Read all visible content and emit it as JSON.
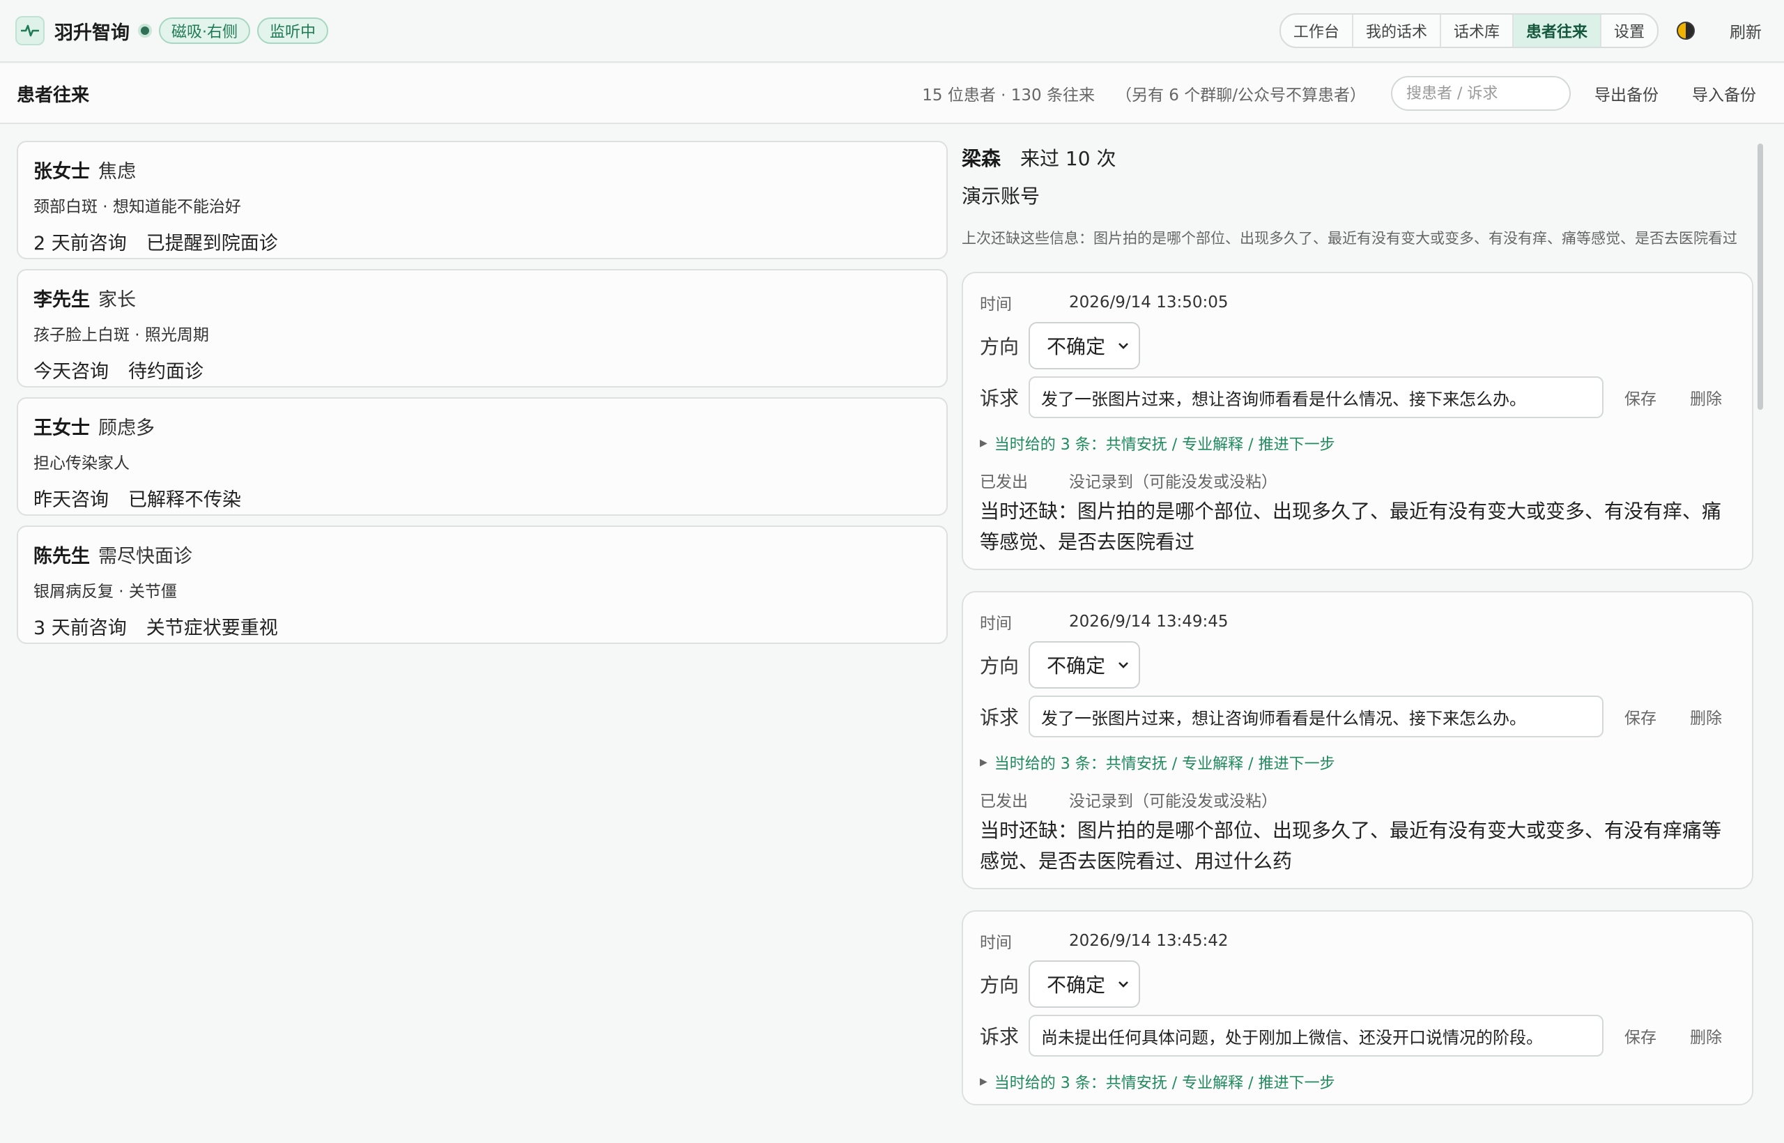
{
  "app": {
    "title": "羽升智询",
    "badges": [
      "磁吸·右侧",
      "监听中"
    ]
  },
  "nav": {
    "tabs": [
      {
        "label": "工作台",
        "active": false
      },
      {
        "label": "我的话术",
        "active": false
      },
      {
        "label": "话术库",
        "active": false
      },
      {
        "label": "患者往来",
        "active": true
      },
      {
        "label": "设置",
        "active": false
      }
    ],
    "refresh_label": "刷新"
  },
  "page": {
    "title": "患者往来",
    "stats": "15 位患者 · 130 条往来",
    "stats_note": "（另有 6 个群聊/公众号不算患者）",
    "search_placeholder": "搜患者 / 诉求",
    "export_label": "导出备份",
    "import_label": "导入备份"
  },
  "patients": [
    {
      "name": "张女士",
      "tag": "焦虑",
      "desc": "颈部白斑 · 想知道能不能治好",
      "when": "2 天前咨询",
      "status": "已提醒到院面诊"
    },
    {
      "name": "李先生",
      "tag": "家长",
      "desc": "孩子脸上白斑 · 照光周期",
      "when": "今天咨询",
      "status": "待约面诊"
    },
    {
      "name": "王女士",
      "tag": "顾虑多",
      "desc": "担心传染家人",
      "when": "昨天咨询",
      "status": "已解释不传染"
    },
    {
      "name": "陈先生",
      "tag": "需尽快面诊",
      "desc": "银屑病反复 · 关节僵",
      "when": "3 天前咨询",
      "status": "关节症状要重视"
    }
  ],
  "detail": {
    "name": "梁森",
    "visits": "来过 10 次",
    "note": "演示账号",
    "missing": "上次还缺这些信息：图片拍的是哪个部位、出现多久了、最近有没有变大或变多、有没有痒、痛等感觉、是否去医院看过",
    "labels": {
      "time": "时间",
      "direction": "方向",
      "request": "诉求",
      "save": "保存",
      "delete": "删除",
      "sent": "已发出"
    },
    "entries": [
      {
        "time": "2026/9/14 13:50:05",
        "direction": "不确定",
        "request": "发了一张图片过来，想让咨询师看看是什么情况、接下来怎么办。",
        "hint": "当时给的 3 条：共情安抚 / 专业解释 / 推进下一步",
        "sent": "没记录到（可能没发或没粘）",
        "lack": "当时还缺：图片拍的是哪个部位、出现多久了、最近有没有变大或变多、有没有痒、痛等感觉、是否去医院看过"
      },
      {
        "time": "2026/9/14 13:49:45",
        "direction": "不确定",
        "request": "发了一张图片过来，想让咨询师看看是什么情况、接下来怎么办。",
        "hint": "当时给的 3 条：共情安抚 / 专业解释 / 推进下一步",
        "sent": "没记录到（可能没发或没粘）",
        "lack": "当时还缺：图片拍的是哪个部位、出现多久了、最近有没有变大或变多、有没有痒痛等感觉、是否去医院看过、用过什么药"
      },
      {
        "time": "2026/9/14 13:45:42",
        "direction": "不确定",
        "request": "尚未提出任何具体问题，处于刚加上微信、还没开口说情况的阶段。",
        "hint": "当时给的 3 条：共情安抚 / 专业解释 / 推进下一步"
      }
    ]
  },
  "colors": {
    "accent": "#1f8a5e",
    "active_tab_bg": "#dcf2e8",
    "badge_bg": "#e3f4ec"
  }
}
